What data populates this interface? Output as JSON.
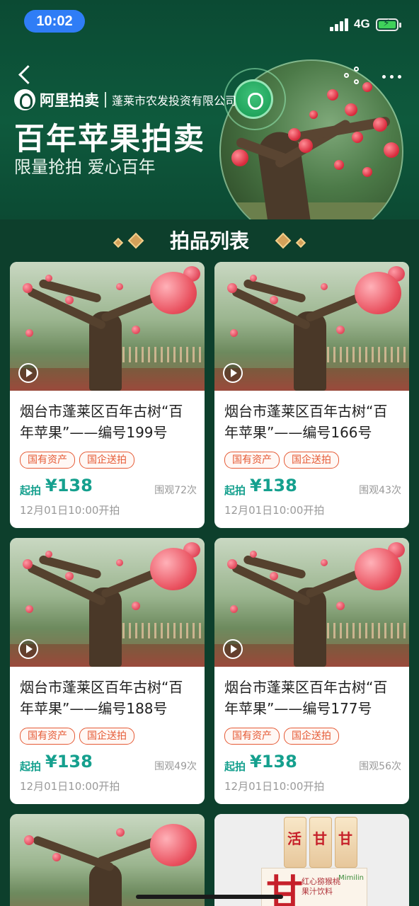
{
  "status_bar": {
    "time": "10:02",
    "network": "4G"
  },
  "header": {
    "brand_name": "阿里拍卖",
    "company": "蓬莱市农发投资有限公司",
    "title": "百年苹果拍卖",
    "subtitle": "限量抢拍 爱心百年"
  },
  "section": {
    "title": "拍品列表"
  },
  "items": [
    {
      "title": "烟台市蓬莱区百年古树“百年苹果”——编号199号",
      "tags": [
        "国有资产",
        "国企送拍"
      ],
      "price_label": "起拍",
      "price": "¥138",
      "views": "围观72次",
      "start_time": "12月01日10:00开拍"
    },
    {
      "title": "烟台市蓬莱区百年古树“百年苹果”——编号166号",
      "tags": [
        "国有资产",
        "国企送拍"
      ],
      "price_label": "起拍",
      "price": "¥138",
      "views": "围观43次",
      "start_time": "12月01日10:00开拍"
    },
    {
      "title": "烟台市蓬莱区百年古树“百年苹果”——编号188号",
      "tags": [
        "国有资产",
        "国企送拍"
      ],
      "price_label": "起拍",
      "price": "¥138",
      "views": "围观49次",
      "start_time": "12月01日10:00开拍"
    },
    {
      "title": "烟台市蓬莱区百年古树“百年苹果”——编号177号",
      "tags": [
        "国有资产",
        "国企送拍"
      ],
      "price_label": "起拍",
      "price": "¥138",
      "views": "围观56次",
      "start_time": "12月01日10:00开拍"
    }
  ],
  "drink_card": {
    "can_chars": [
      "活",
      "甘",
      "甘"
    ],
    "box_big": "甘",
    "box_text": "红心猕猴桃果汁饮料",
    "box_brand": "Mimilin"
  },
  "colors": {
    "background": "#0d3f2c",
    "price": "#15a08e",
    "tag": "#e55a35"
  }
}
